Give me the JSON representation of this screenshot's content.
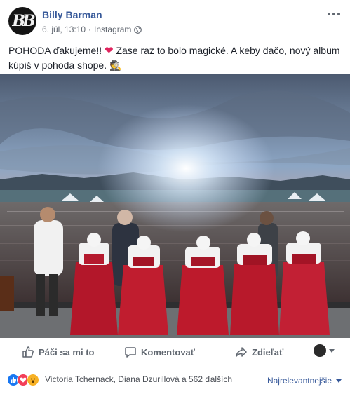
{
  "post": {
    "author": "Billy Barman",
    "avatar_text": "BB",
    "date": "6. júl, 13:10",
    "separator": "·",
    "source": "Instagram",
    "privacy_icon": "globe-icon",
    "text_before_heart": "POHODA ďakujeme!! ",
    "heart_emoji": "❤",
    "text_after_heart": " Zase raz to bolo magické. A keby dačo, nový album kúpiš v pohoda shope.",
    "spy_emoji": "🕵"
  },
  "actions": {
    "like_label": "Páči sa mi to",
    "comment_label": "Komentovať",
    "share_label": "Zdieľať"
  },
  "reactions": {
    "types": [
      "like",
      "love",
      "wow"
    ],
    "summary": "Victoria Tchernack, Diana Dzurillová a 562 ďalších",
    "sort_label": "Najrelevantnejšie"
  },
  "colors": {
    "link": "#365899",
    "muted": "#616770",
    "like": "#1877f2",
    "love": "#f33e58",
    "wow": "#f7b125"
  }
}
